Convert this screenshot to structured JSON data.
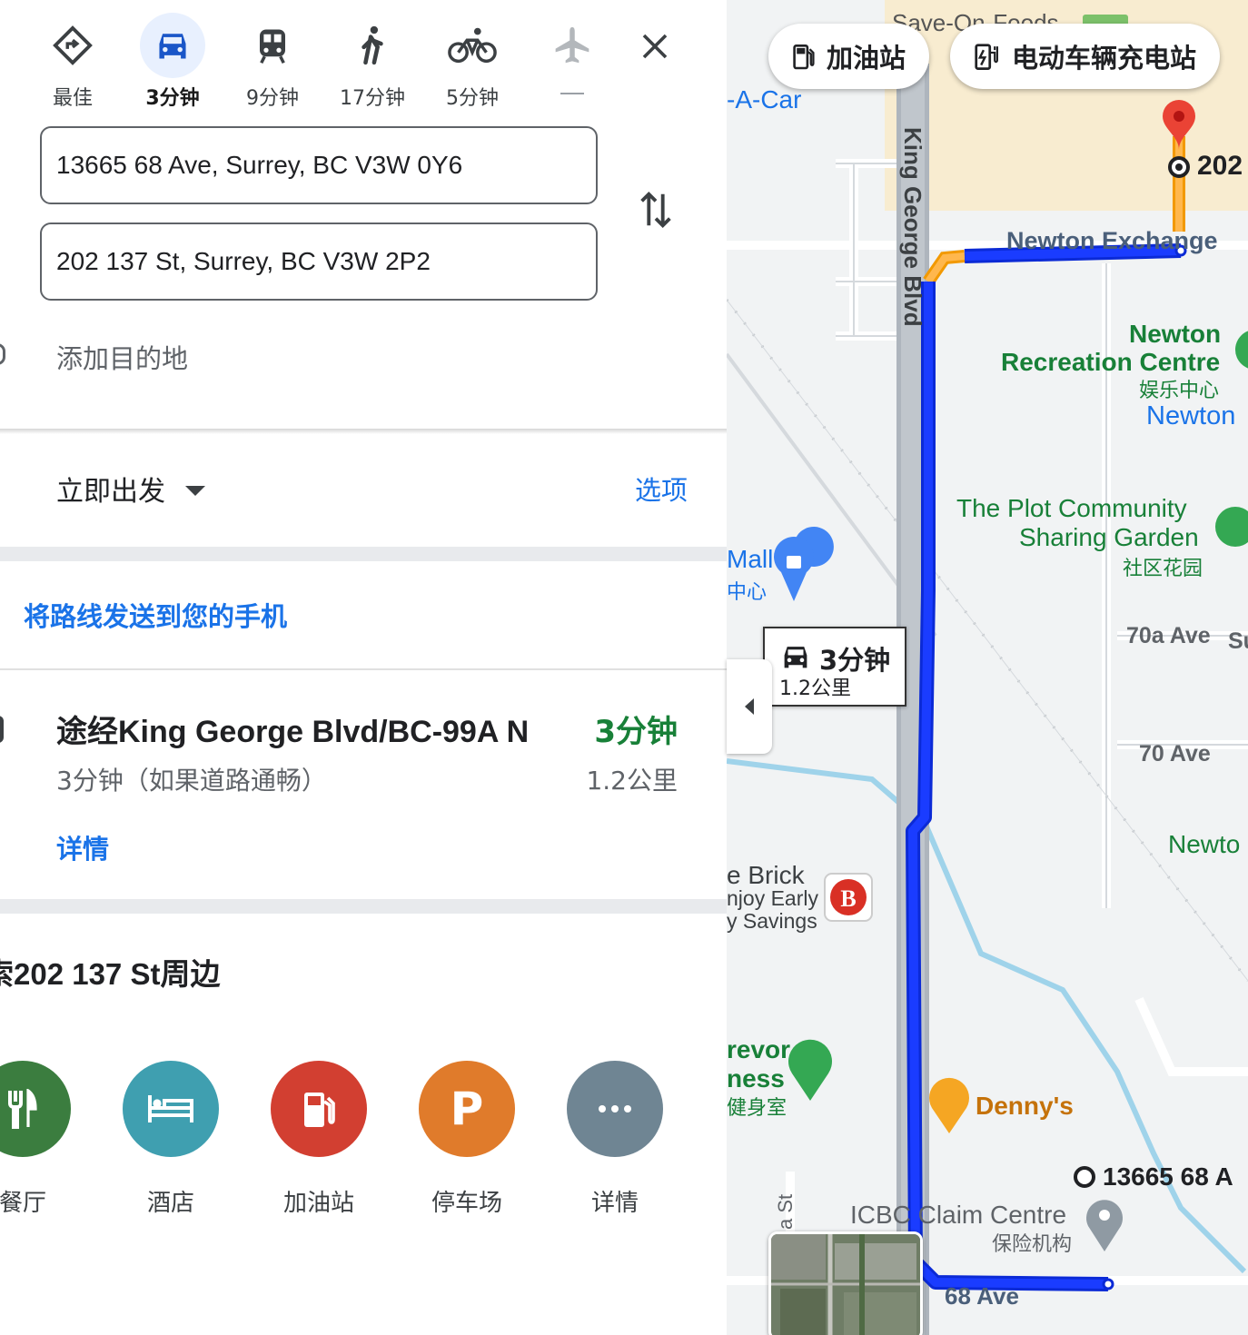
{
  "travel_modes": [
    {
      "label": "最佳",
      "icon": "best-route-icon",
      "active": false
    },
    {
      "label": "3分钟",
      "icon": "car-icon",
      "active": true
    },
    {
      "label": "9分钟",
      "icon": "transit-icon",
      "active": false
    },
    {
      "label": "17分钟",
      "icon": "walk-icon",
      "active": false
    },
    {
      "label": "5分钟",
      "icon": "bike-icon",
      "active": false
    },
    {
      "label": "",
      "icon": "flight-icon",
      "active": false
    }
  ],
  "directions": {
    "origin": "13665 68 Ave, Surrey, BC V3W 0Y6",
    "destination": "202 137 St, Surrey, BC V3W 2P2",
    "add_destination": "添加目的地"
  },
  "depart": {
    "label": "立即出发",
    "options": "选项"
  },
  "send_to_phone": "将路线发送到您的手机",
  "route": {
    "title": "途经King George Blvd/BC-99A N",
    "time": "3分钟",
    "subtitle": "3分钟（如果道路通畅）",
    "distance": "1.2公里",
    "details": "详情"
  },
  "nearby": {
    "title": "索202 137 St周边",
    "categories": [
      {
        "label": "餐厅",
        "icon": "restaurant-icon",
        "color": "#3b7d3f"
      },
      {
        "label": "酒店",
        "icon": "hotel-icon",
        "color": "#3f9fb0"
      },
      {
        "label": "加油站",
        "icon": "gas-station-icon",
        "color": "#d23f31"
      },
      {
        "label": "停车场",
        "icon": "parking-icon",
        "color": "#e07b2b"
      },
      {
        "label": "详情",
        "icon": "more-icon",
        "color": "#6f8593"
      }
    ]
  },
  "map": {
    "chips": [
      {
        "label": "加油站",
        "icon": "gas-pump-icon"
      },
      {
        "label": "电动车辆充电站",
        "icon": "ev-charger-icon"
      }
    ],
    "route_callout": {
      "time": "3分钟",
      "distance": "1.2公里"
    },
    "labels": {
      "save_on_foods": "Save-On-Foods",
      "rent_a_car": "-A-Car",
      "king_george": "King George Blvd",
      "dest_marker": "202",
      "newton_exchange": "Newton Exchange",
      "newton_rec_1": "Newton",
      "newton_rec_2": "Recreation Centre",
      "newton_rec_cn": "娱乐中心",
      "newton_area": "Newton",
      "plot_1": "The Plot Community",
      "plot_2": "Sharing Garden",
      "plot_cn": "社区花园",
      "mall": "Mall",
      "mall_cn": "中心",
      "ave70a": "70a Ave",
      "ave70a_su": "Su",
      "ave70": "70 Ave",
      "newton_partial": "Newto",
      "brick_1": "e Brick",
      "brick_2": "njoy Early",
      "brick_3": "y Savings",
      "trevor_1": "revor",
      "trevor_2": "ness",
      "trevor_cn": "健身室",
      "dennys": "Denny's",
      "origin_marker": "13665 68 A",
      "icbc": "ICBC Claim Centre",
      "icbc_cn": "保险机构",
      "ave68": "68 Ave",
      "st_vertical": "a St"
    }
  }
}
